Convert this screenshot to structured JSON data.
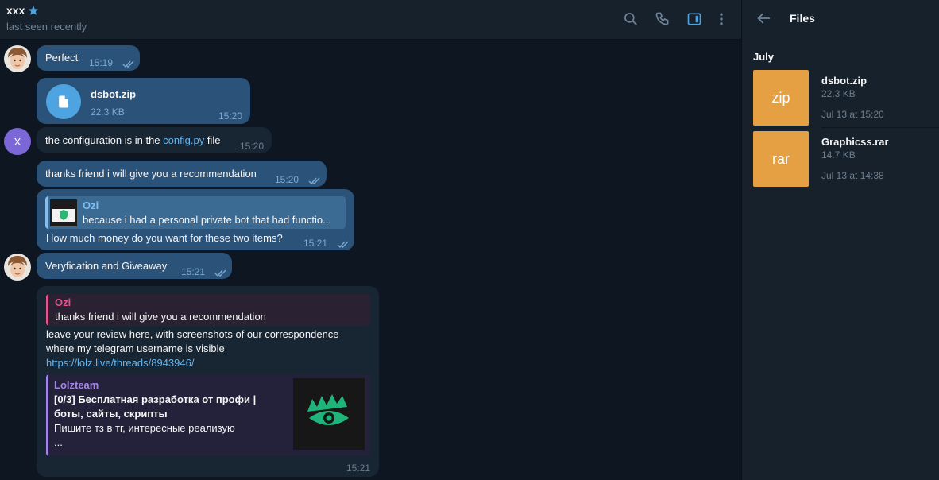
{
  "chat": {
    "title": "xxx",
    "status": "last seen recently",
    "header_icons": [
      "search-icon",
      "phone-icon",
      "sidebar-toggle-icon",
      "more-vertical-icon"
    ]
  },
  "messages": {
    "m1": {
      "text": "Perfect",
      "time": "15:19"
    },
    "m2": {
      "file_name": "dsbot.zip",
      "file_size": "22.3 KB",
      "time": "15:20"
    },
    "m3": {
      "avatar_letter": "X",
      "text_before": "the configuration is in the ",
      "link": "config.py",
      "text_after": " file",
      "time": "15:20"
    },
    "m4": {
      "text": "thanks friend i will give you a recommendation",
      "time": "15:20"
    },
    "m5": {
      "reply_author": "Ozi",
      "reply_text": "because i had a personal private bot that had functio...",
      "text": "How much money do you want for these two items?",
      "time": "15:21"
    },
    "m6": {
      "text": "Veryfication and Giveaway",
      "time": "15:21"
    },
    "m7": {
      "reply_author": "Ozi",
      "reply_text": "thanks friend i will give you a recommendation",
      "line1": "leave your review here, with screenshots of our correspondence",
      "line2": "where my telegram username is visible",
      "link": "https://lolz.live/threads/8943946/",
      "preview_site": "Lolzteam",
      "preview_title_1": "[0/3] Бесплатная разработка от профи |",
      "preview_title_2": "боты, сайты, скрипты",
      "preview_desc": "Пишите тз в тг, интересные реализую",
      "preview_more": "...",
      "time": "15:21"
    }
  },
  "files_panel": {
    "title": "Files",
    "month": "July",
    "files": [
      {
        "ext": "zip",
        "name": "dsbot.zip",
        "size": "22.3 KB",
        "date": "Jul 13 at 15:20"
      },
      {
        "ext": "rar",
        "name": "Graphicss.rar",
        "size": "14.7 KB",
        "date": "Jul 13 at 14:38"
      }
    ]
  },
  "colors": {
    "background": "#0e1621",
    "header": "#17212b",
    "outgoing_bubble": "#2b5278",
    "incoming_bubble": "#182533",
    "accent": "#64b5ef",
    "file_thumb": "#e4a043",
    "reply_pink": "#e0578e",
    "reply_purple": "#a585e8"
  }
}
